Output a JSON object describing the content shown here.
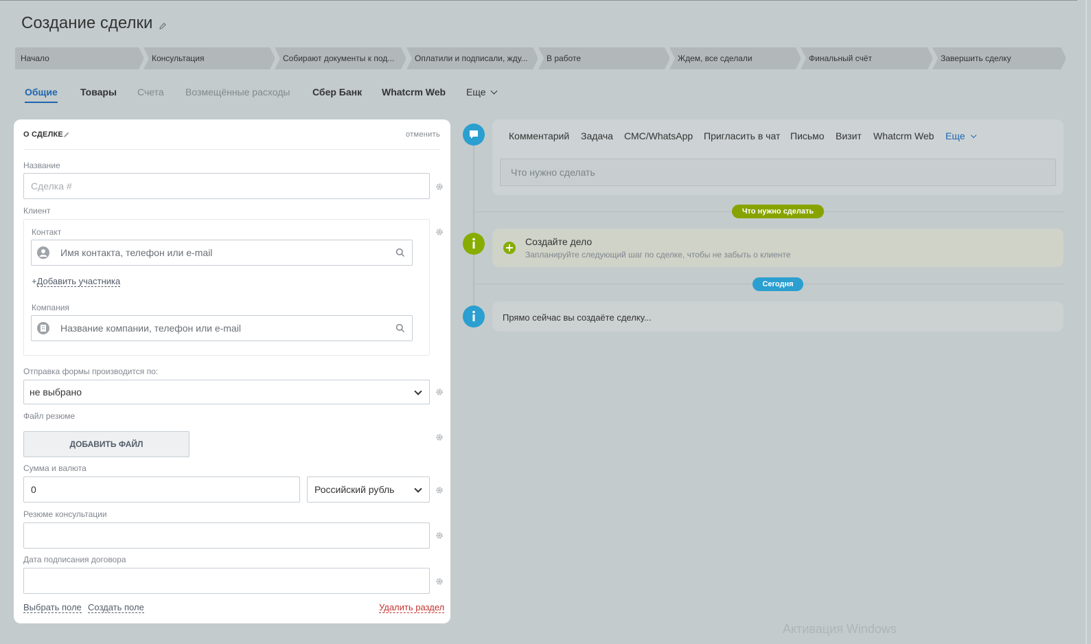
{
  "page": {
    "title": "Создание сделки"
  },
  "stages": [
    "Начало",
    "Консультация",
    "Собирают документы к под...",
    "Оплатили и подписали, жду...",
    "В работе",
    "Ждем, все сделали",
    "Финальный счёт",
    "Завершить сделку"
  ],
  "tabs": {
    "general": "Общие",
    "products": "Товары",
    "invoices": "Счета",
    "expenses": "Возмещённые расходы",
    "sber": "Сбер Банк",
    "whatcrm": "Whatcrm Web",
    "more": "Еще"
  },
  "panel": {
    "title": "О СДЕЛКЕ",
    "cancel": "отменить",
    "name_label": "Название",
    "name_placeholder": "Сделка #",
    "client_label": "Клиент",
    "contact_label": "Контакт",
    "contact_placeholder": "Имя контакта, телефон или e-mail",
    "add_member": "Добавить участника",
    "company_label": "Компания",
    "company_placeholder": "Название компании, телефон или e-mail",
    "form_label": "Отправка формы производится по:",
    "form_value": "не выбрано",
    "resume_file_label": "Файл резюме",
    "add_file": "ДОБАВИТЬ ФАЙЛ",
    "amount_label": "Сумма и валюта",
    "amount_value": "0",
    "currency_value": "Российский рубль",
    "consult_label": "Резюме консультации",
    "consult_value": "",
    "date_label": "Дата подписания договора",
    "date_value": "",
    "choose_field": "Выбрать поле",
    "create_field": "Создать поле",
    "delete_section": "Удалить раздел"
  },
  "timeline": {
    "tabs": {
      "comment": "Комментарий",
      "task": "Задача",
      "sms": "СМС/WhatsApp",
      "invite": "Пригласить в чат",
      "letter": "Письмо",
      "visit": "Визит",
      "whatcrm": "Whatcrm Web",
      "more": "Еще"
    },
    "input_placeholder": "Что нужно сделать",
    "todo_pill": "Что нужно сделать",
    "todo_title": "Создайте дело",
    "todo_sub": "Запланируйте следующий шаг по сделке, чтобы не забыть о клиенте",
    "today_pill": "Сегодня",
    "now_text": "Прямо сейчас вы создаёте сделку..."
  },
  "watermark": "Активация Windows",
  "colors": {
    "background": "#c4cbcc",
    "accent_blue": "#2066b0",
    "timeline_blue": "#2a9fd0",
    "timeline_green": "#86ad00",
    "danger": "#c3322f"
  }
}
